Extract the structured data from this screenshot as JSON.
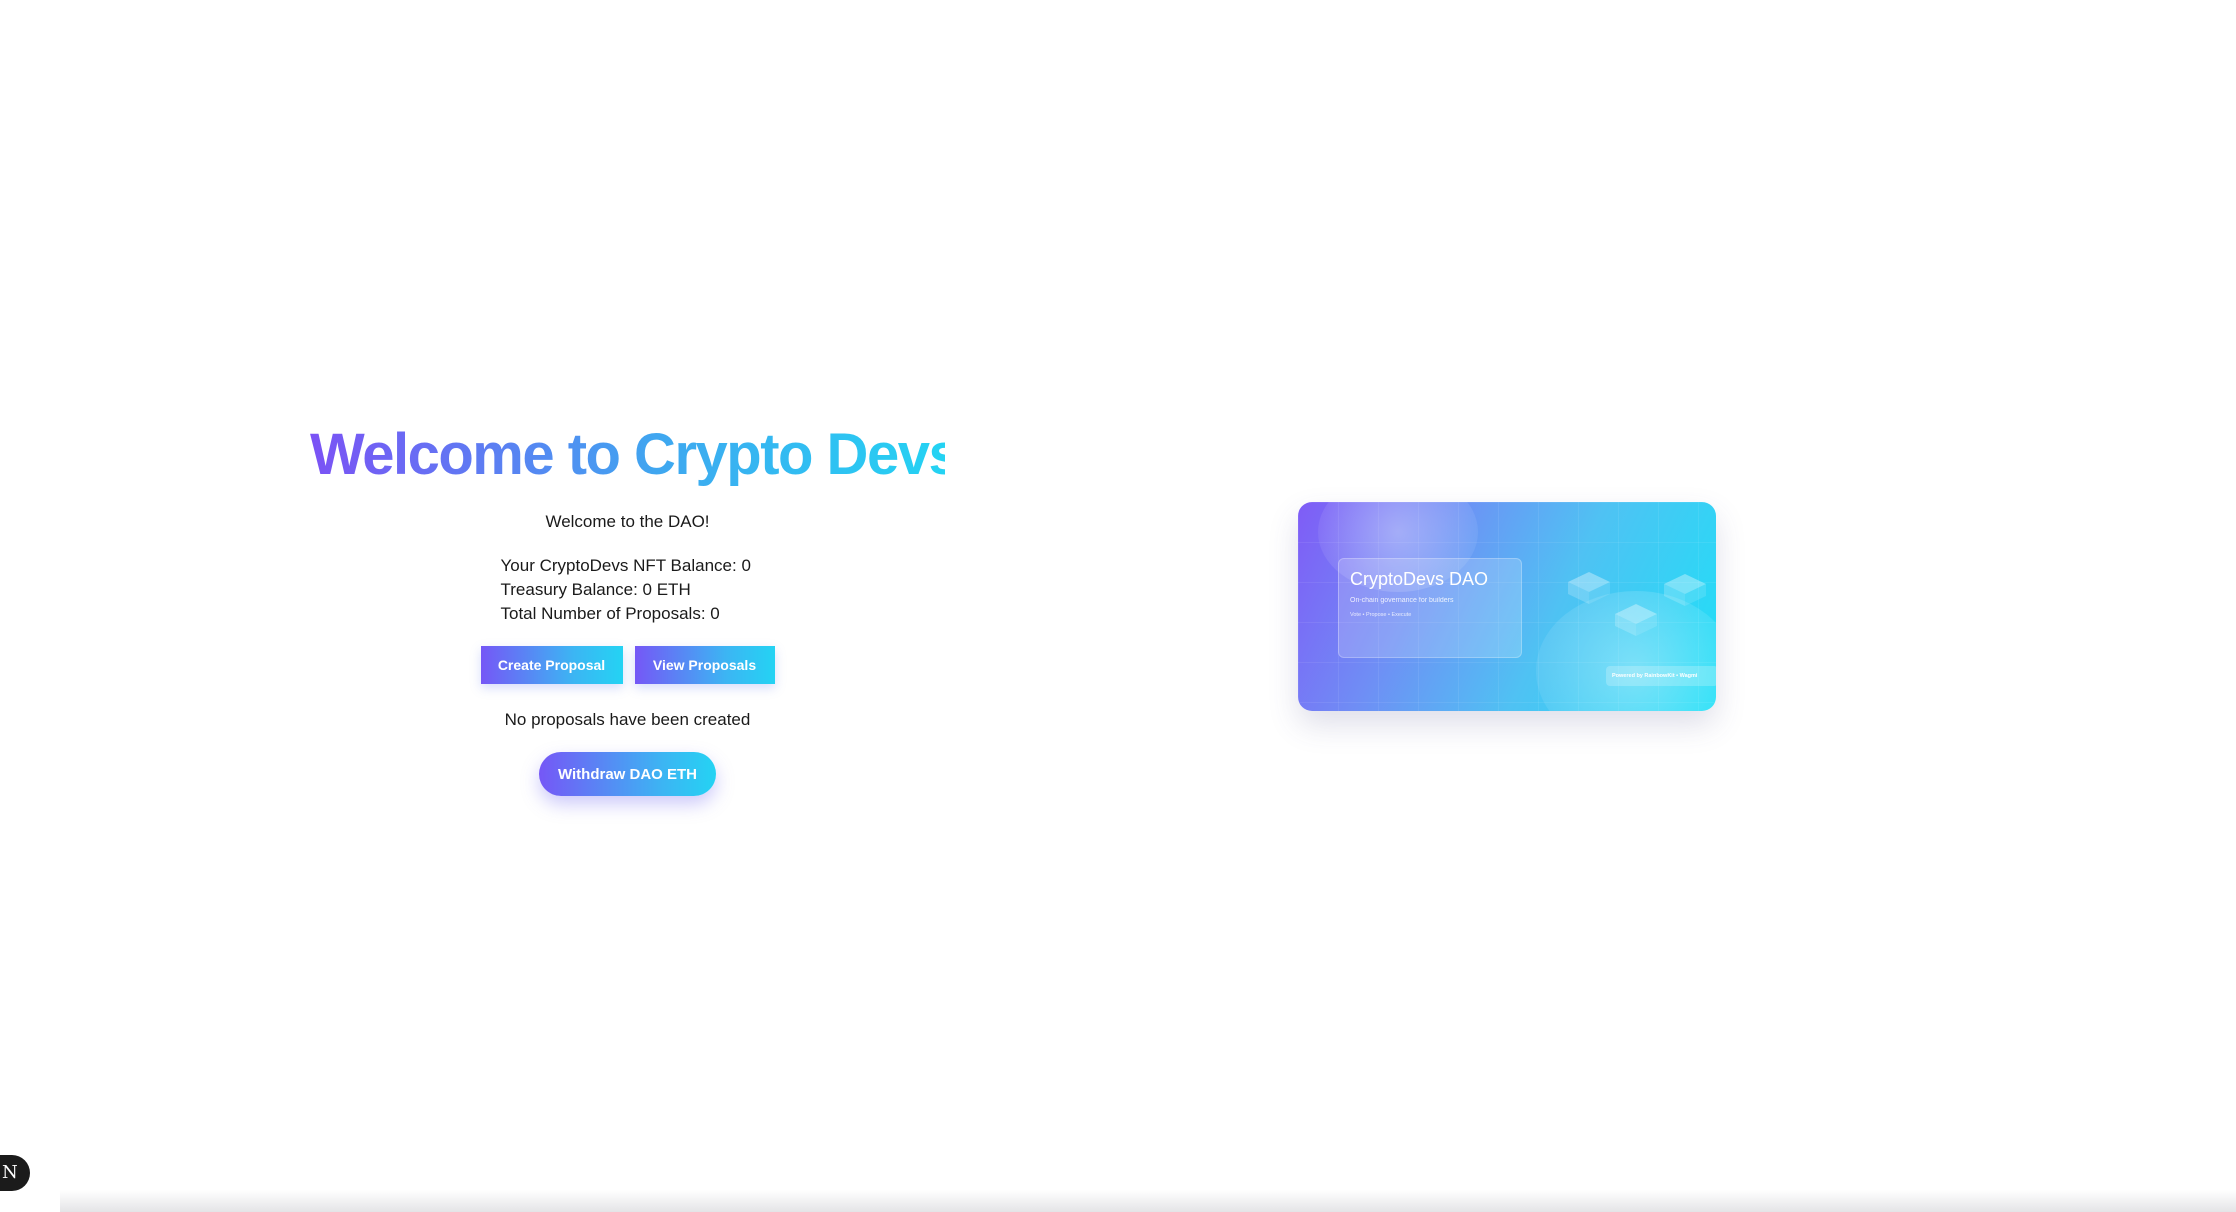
{
  "hero": {
    "title": "Welcome to Crypto Devs!",
    "welcome": "Welcome to the DAO!"
  },
  "stats": {
    "nft_balance": "Your CryptoDevs NFT Balance: 0",
    "treasury_balance": "Treasury Balance: 0 ETH",
    "total_proposals": "Total Number of Proposals: 0"
  },
  "actions": {
    "create_label": "Create Proposal",
    "view_label": "View Proposals",
    "withdraw_label": "Withdraw DAO ETH"
  },
  "proposals": {
    "empty_message": "No proposals have been created"
  },
  "banner": {
    "title": "CryptoDevs DAO",
    "subtitle": "On-chain governance for builders",
    "tags": "Vote • Propose • Execute",
    "powered": "Powered by RainbowKit • Wagmi"
  },
  "dev_badge": {
    "letter": "N"
  },
  "colors": {
    "gradient_start": "#7557f6",
    "gradient_end": "#24d3f3"
  }
}
